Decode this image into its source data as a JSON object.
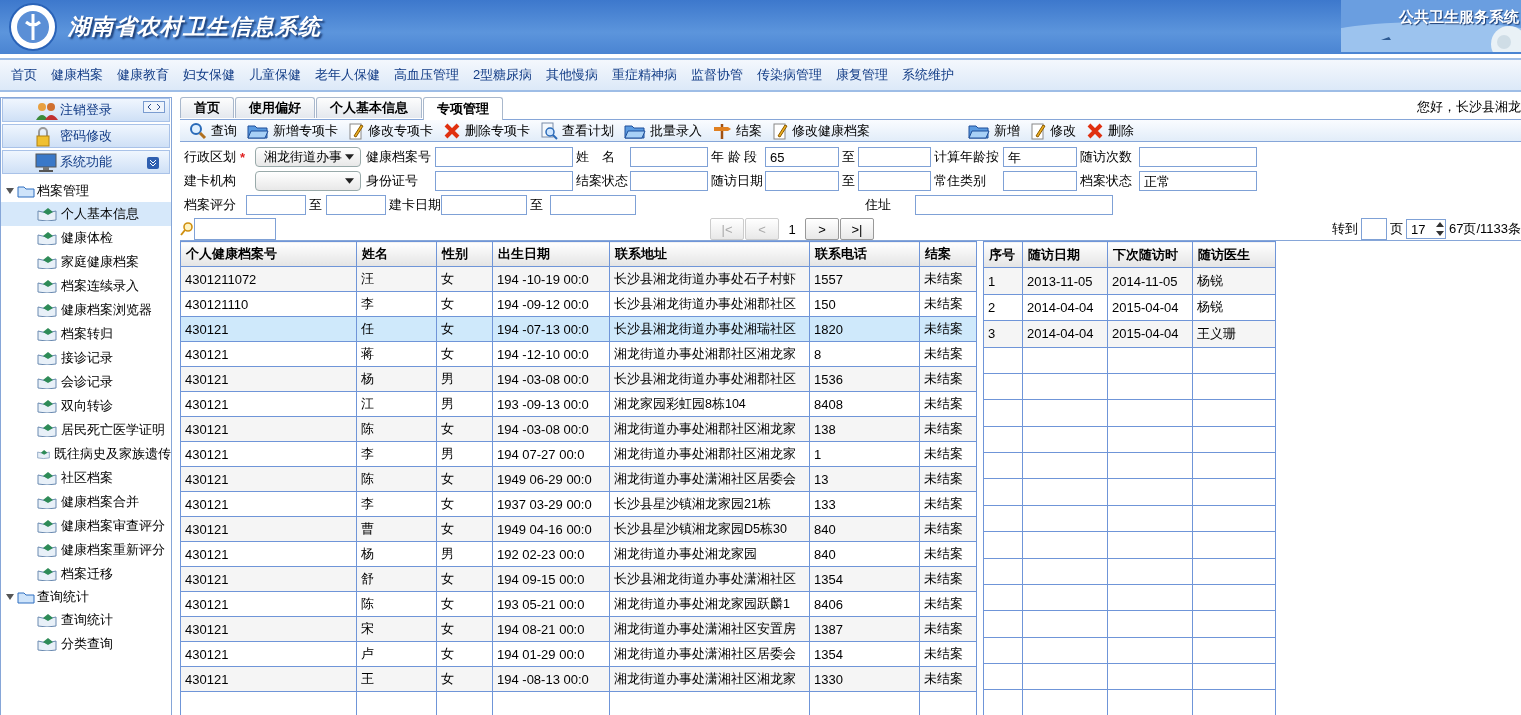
{
  "header": {
    "title": "湖南省农村卫生信息系统",
    "subtitle": "公共卫生服务系统"
  },
  "nav": [
    "首页",
    "健康档案",
    "健康教育",
    "妇女保健",
    "儿童保健",
    "老年人保健",
    "高血压管理",
    "2型糖尿病",
    "其他慢病",
    "重症精神病",
    "监督协管",
    "传染病管理",
    "康复管理",
    "系统维护"
  ],
  "sidebar": {
    "buttons": [
      "注销登录",
      "密码修改",
      "系统功能"
    ],
    "tree": [
      {
        "label": "档案管理",
        "expanded": true,
        "children": [
          {
            "label": "个人基本信息",
            "selected": true
          },
          {
            "label": "健康体检",
            "selected": false
          },
          {
            "label": "家庭健康档案",
            "selected": false
          },
          {
            "label": "档案连续录入",
            "selected": false
          },
          {
            "label": "健康档案浏览器",
            "selected": false
          },
          {
            "label": "档案转归",
            "selected": false
          },
          {
            "label": "接诊记录",
            "selected": false
          },
          {
            "label": "会诊记录",
            "selected": false
          },
          {
            "label": "双向转诊",
            "selected": false
          },
          {
            "label": "居民死亡医学证明",
            "selected": false
          },
          {
            "label": "既往病史及家族遗传",
            "selected": false
          },
          {
            "label": "社区档案",
            "selected": false
          },
          {
            "label": "健康档案合并",
            "selected": false
          },
          {
            "label": "健康档案审查评分",
            "selected": false
          },
          {
            "label": "健康档案重新评分",
            "selected": false
          },
          {
            "label": "档案迁移",
            "selected": false
          }
        ]
      },
      {
        "label": "查询统计",
        "expanded": true,
        "children": [
          {
            "label": "查询统计",
            "selected": false
          },
          {
            "label": "分类查询",
            "selected": false
          }
        ]
      }
    ]
  },
  "tabs": [
    {
      "label": "首页",
      "selected": false
    },
    {
      "label": "使用偏好",
      "selected": false
    },
    {
      "label": "个人基本信息",
      "selected": false
    },
    {
      "label": "专项管理",
      "selected": true
    }
  ],
  "greeting": "您好，长沙县湘龙",
  "toolbar": {
    "left": [
      "查询",
      "新增专项卡",
      "修改专项卡",
      "删除专项卡",
      "查看计划",
      "批量录入",
      "结案",
      "修改健康档案"
    ],
    "right": [
      "新增",
      "修改",
      "删除"
    ]
  },
  "form": {
    "rows": [
      [
        {
          "kind": "label",
          "text": "行政区划",
          "mark": "*"
        },
        {
          "kind": "select",
          "value": "湘龙街道办事"
        },
        {
          "kind": "label",
          "text": "健康档案号"
        },
        {
          "kind": "input"
        },
        {
          "kind": "label",
          "text": "姓　名"
        },
        {
          "kind": "input"
        },
        {
          "kind": "label",
          "text": "年 龄 段"
        },
        {
          "kind": "input",
          "value": "65"
        },
        {
          "kind": "label",
          "text": "至"
        },
        {
          "kind": "input"
        },
        {
          "kind": "label",
          "text": "计算年龄按"
        },
        {
          "kind": "input",
          "value": "年"
        },
        {
          "kind": "label",
          "text": "随访次数"
        },
        {
          "kind": "input"
        }
      ],
      [
        {
          "kind": "label",
          "text": "建卡机构"
        },
        {
          "kind": "select"
        },
        {
          "kind": "label",
          "text": "身份证号"
        },
        {
          "kind": "input"
        },
        {
          "kind": "label",
          "text": "结案状态"
        },
        {
          "kind": "input"
        },
        {
          "kind": "label",
          "text": "随访日期"
        },
        {
          "kind": "input"
        },
        {
          "kind": "label",
          "text": "至"
        },
        {
          "kind": "input"
        },
        {
          "kind": "label",
          "text": "常住类别"
        },
        {
          "kind": "input"
        },
        {
          "kind": "label",
          "text": "档案状态"
        },
        {
          "kind": "input",
          "value": "正常"
        }
      ]
    ],
    "row3": [
      {
        "kind": "label",
        "text": "档案评分"
      },
      {
        "kind": "input"
      },
      {
        "kind": "label",
        "text": "至"
      },
      {
        "kind": "input"
      },
      {
        "kind": "label",
        "text": "建卡日期"
      },
      {
        "kind": "input"
      },
      {
        "kind": "label",
        "text": "至"
      },
      {
        "kind": "input"
      },
      {
        "kind": "label",
        "text": "住址"
      },
      {
        "kind": "input"
      }
    ]
  },
  "pager": {
    "buttons": [
      {
        "label": "|<",
        "disabled": true
      },
      {
        "label": "<",
        "disabled": true
      },
      {
        "label": ">",
        "disabled": false
      },
      {
        "label": ">|",
        "disabled": false
      }
    ],
    "page": "1",
    "goto_label": "转到",
    "page_label": "页",
    "page_size": "17",
    "summary": "67页/1133条"
  },
  "table": {
    "columns": [
      "个人健康档案号",
      "姓名",
      "性别",
      "出生日期",
      "联系地址",
      "联系电话",
      "结案"
    ],
    "rows": [
      {
        "selected": false,
        "cells": [
          "4301211072",
          "汪",
          "女",
          "194 -10-19 00:0",
          "长沙县湘龙街道办事处石子村虾",
          "1557",
          "未结案"
        ]
      },
      {
        "selected": false,
        "cells": [
          "430121110",
          "李",
          "女",
          "194 -09-12 00:0",
          "长沙县湘龙街道办事处湘郡社区",
          "150",
          "未结案"
        ]
      },
      {
        "selected": true,
        "cells": [
          "430121",
          "任",
          "女",
          "194 -07-13 00:0",
          "长沙县湘龙街道办事处湘瑞社区",
          "1820",
          "未结案"
        ]
      },
      {
        "selected": false,
        "cells": [
          "430121",
          "蒋",
          "女",
          "194 -12-10 00:0",
          "湘龙街道办事处湘郡社区湘龙家",
          "8",
          "未结案"
        ]
      },
      {
        "selected": false,
        "cells": [
          "430121",
          "杨",
          "男",
          "194 -03-08 00:0",
          "长沙县湘龙街道办事处湘郡社区",
          "1536",
          "未结案"
        ]
      },
      {
        "selected": false,
        "cells": [
          "430121",
          "江",
          "男",
          "193 -09-13 00:0",
          "湘龙家园彩虹园8栋104",
          "8408",
          "未结案"
        ]
      },
      {
        "selected": false,
        "cells": [
          "430121",
          "陈",
          "女",
          "194 -03-08 00:0",
          "湘龙街道办事处湘郡社区湘龙家",
          "138",
          "未结案"
        ]
      },
      {
        "selected": false,
        "cells": [
          "430121",
          "李",
          "男",
          "194 07-27 00:0",
          "湘龙街道办事处湘郡社区湘龙家",
          "1",
          "未结案"
        ]
      },
      {
        "selected": false,
        "cells": [
          "430121",
          "陈",
          "女",
          "1949 06-29 00:0",
          "湘龙街道办事处潇湘社区居委会",
          "13",
          "未结案"
        ]
      },
      {
        "selected": false,
        "cells": [
          "430121",
          "李",
          "女",
          "1937 03-29 00:0",
          "长沙县星沙镇湘龙家园21栋",
          "133",
          "未结案"
        ]
      },
      {
        "selected": false,
        "cells": [
          "430121",
          "曹",
          "女",
          "1949 04-16 00:0",
          "长沙县星沙镇湘龙家园D5栋30",
          "840",
          "未结案"
        ]
      },
      {
        "selected": false,
        "cells": [
          "430121",
          "杨",
          "男",
          "192 02-23 00:0",
          "湘龙街道办事处湘龙家园",
          "840",
          "未结案"
        ]
      },
      {
        "selected": false,
        "cells": [
          "430121",
          "舒",
          "女",
          "194 09-15 00:0",
          "长沙县湘龙街道办事处潇湘社区",
          "1354",
          "未结案"
        ]
      },
      {
        "selected": false,
        "cells": [
          "430121",
          "陈",
          "女",
          "193 05-21 00:0",
          "湘龙街道办事处湘龙家园跃麟1",
          "8406",
          "未结案"
        ]
      },
      {
        "selected": false,
        "cells": [
          "430121",
          "宋",
          "女",
          "194 08-21 00:0",
          "湘龙街道办事处潇湘社区安置房",
          "1387",
          "未结案"
        ]
      },
      {
        "selected": false,
        "cells": [
          "430121",
          "卢",
          "女",
          "194 01-29 00:0",
          "湘龙街道办事处潇湘社区居委会",
          "1354",
          "未结案"
        ]
      },
      {
        "selected": false,
        "cells": [
          "430121",
          "王",
          "女",
          "194 -08-13 00:0",
          "湘龙街道办事处潇湘社区湘龙家",
          "1330",
          "未结案"
        ]
      }
    ]
  },
  "visits": {
    "columns": [
      "序号",
      "随访日期",
      "下次随访时",
      "随访医生"
    ],
    "rows": [
      [
        "1",
        "2013-11-05",
        "2014-11-05",
        "杨锐"
      ],
      [
        "2",
        "2014-04-04",
        "2015-04-04",
        "杨锐"
      ],
      [
        "3",
        "2014-04-04",
        "2015-04-04",
        "王义珊"
      ]
    ]
  }
}
